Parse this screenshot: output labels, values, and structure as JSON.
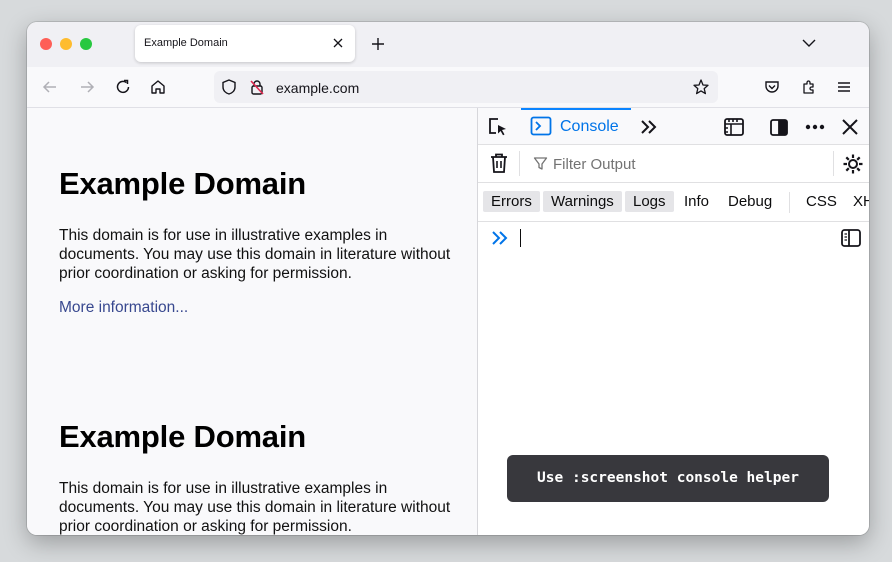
{
  "browser": {
    "tab_title": "Example Domain",
    "url": "example.com"
  },
  "page": {
    "sections": [
      {
        "heading": "Example Domain",
        "paragraph": "This domain is for use in illustrative examples in documents. You may use this domain in literature without prior coordination or asking for permission.",
        "link": "More information..."
      },
      {
        "heading": "Example Domain",
        "paragraph": "This domain is for use in illustrative examples in documents. You may use this domain in literature without prior coordination or asking for permission."
      }
    ]
  },
  "devtools": {
    "active_tab": "Console",
    "filter_placeholder": "Filter Output",
    "levels": [
      {
        "label": "Errors",
        "active": true
      },
      {
        "label": "Warnings",
        "active": true
      },
      {
        "label": "Logs",
        "active": true
      },
      {
        "label": "Info",
        "active": false
      },
      {
        "label": "Debug",
        "active": false
      },
      {
        "label": "CSS",
        "active": false
      },
      {
        "label": "XH",
        "active": false
      }
    ]
  },
  "toast": "Use :screenshot console helper",
  "colors": {
    "accent": "#0a84ff",
    "link": "#38488f",
    "toast_bg": "#38383d"
  }
}
